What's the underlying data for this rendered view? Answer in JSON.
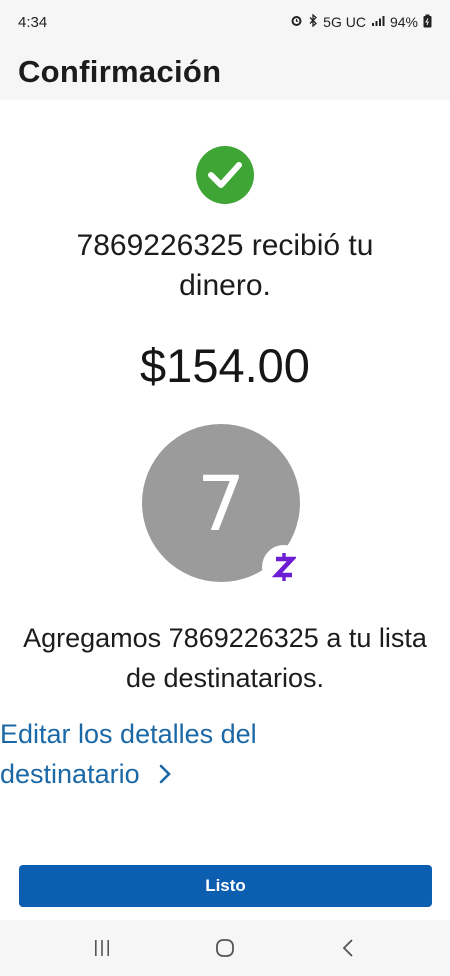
{
  "status_bar": {
    "time": "4:34",
    "network": "5G UC",
    "battery": "94%",
    "icons": [
      "alarm-icon",
      "bluetooth-icon",
      "signal-icon",
      "battery-icon"
    ]
  },
  "header": {
    "title": "Confirmación"
  },
  "confirmation": {
    "success_icon": "check-circle-icon",
    "received_message": "7869226325 recibió tu dinero.",
    "amount": "$154.00"
  },
  "recipient": {
    "avatar_initial": "7",
    "badge_icon": "zelle-icon",
    "added_message": "Agregamos 7869226325 a tu lista de destinatarios."
  },
  "edit_link": {
    "label": "Editar los detalles del destinatario"
  },
  "done_button": {
    "label": "Listo"
  },
  "nav_bar": {
    "icons": [
      "recents-icon",
      "home-icon",
      "back-icon"
    ]
  },
  "colors": {
    "success": "#3fa535",
    "link": "#1b68a6",
    "primary_button": "#0b5eb0",
    "zelle": "#6d1ed4",
    "avatar": "#9b9b9b"
  }
}
